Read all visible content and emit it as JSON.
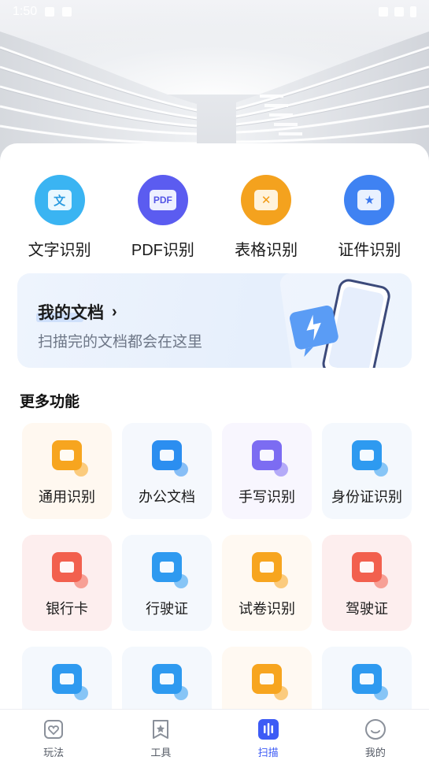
{
  "status_bar": {
    "time": "1:50"
  },
  "quick_actions": [
    {
      "label": "文字识别",
      "icon": "text-recognition-icon",
      "glyph": "文",
      "bg": "#3ab4f2",
      "inner_bg": "#eaf8ff",
      "inner_fg": "#2a9be0"
    },
    {
      "label": "PDF识别",
      "icon": "pdf-recognition-icon",
      "glyph": "PDF",
      "bg": "#5b5cf0",
      "inner_bg": "#eef0ff",
      "inner_fg": "#5355e6"
    },
    {
      "label": "表格识别",
      "icon": "table-recognition-icon",
      "glyph": "✕",
      "bg": "#f4a21e",
      "inner_bg": "#fff3dc",
      "inner_fg": "#f19a12"
    },
    {
      "label": "证件识别",
      "icon": "id-recognition-icon",
      "glyph": "★",
      "bg": "#3f82f2",
      "inner_bg": "#e9f1ff",
      "inner_fg": "#3a78ee"
    }
  ],
  "my_docs": {
    "title": "我的文档",
    "subtitle": "扫描完的文档都会在这里"
  },
  "more": {
    "title": "更多功能",
    "items": [
      {
        "label": "通用识别",
        "icon": "camera-icon",
        "color": "#f7a51f",
        "card": "#fff8f0"
      },
      {
        "label": "办公文档",
        "icon": "word-doc-icon",
        "color": "#2b8ef0",
        "card": "#f5f8fd"
      },
      {
        "label": "手写识别",
        "icon": "pen-icon",
        "color": "#7c6cf2",
        "card": "#f8f6fe"
      },
      {
        "label": "身份证识别",
        "icon": "id-card-icon",
        "color": "#2e9af0",
        "card": "#f4f8fd"
      },
      {
        "label": "银行卡",
        "icon": "bank-card-icon",
        "color": "#f2604e",
        "card": "#fdeeee"
      },
      {
        "label": "行驶证",
        "icon": "vehicle-license-icon",
        "color": "#2e9af0",
        "card": "#f4f8fd"
      },
      {
        "label": "试卷识别",
        "icon": "exam-paper-icon",
        "color": "#f7a51f",
        "card": "#fff9f2"
      },
      {
        "label": "驾驶证",
        "icon": "driver-license-icon",
        "color": "#f2604e",
        "card": "#fdeeee"
      },
      {
        "label": "",
        "icon": "passport-icon",
        "color": "#2e9af0",
        "card": "#f4f8fd"
      },
      {
        "label": "",
        "icon": "number-card-icon",
        "color": "#2e9af0",
        "card": "#f4f8fd"
      },
      {
        "label": "",
        "icon": "certificate-icon",
        "color": "#f7a51f",
        "card": "#fff9f2"
      },
      {
        "label": "",
        "icon": "receipt-icon",
        "color": "#2e9af0",
        "card": "#f4f8fd"
      }
    ]
  },
  "tabs": [
    {
      "label": "玩法",
      "icon": "heart-icon",
      "active": false
    },
    {
      "label": "工具",
      "icon": "star-bookmark-icon",
      "active": false
    },
    {
      "label": "扫描",
      "icon": "scan-icon",
      "active": true
    },
    {
      "label": "我的",
      "icon": "smile-icon",
      "active": false
    }
  ],
  "colors": {
    "accent": "#3d5bf5",
    "text": "#1a1a1a",
    "subtext": "#6e7787"
  }
}
